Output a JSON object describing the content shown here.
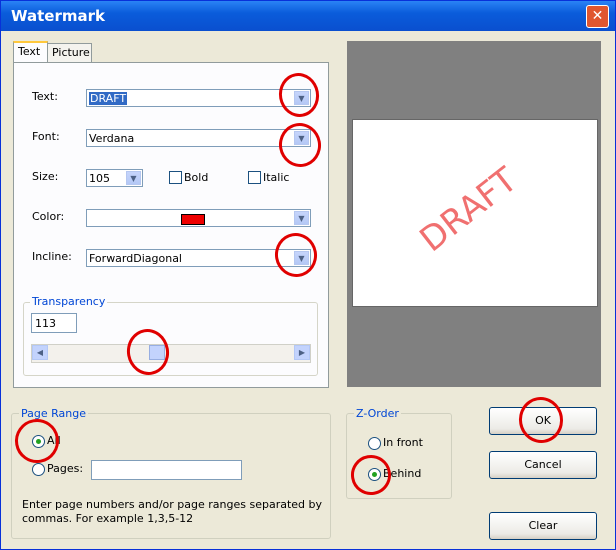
{
  "window": {
    "title": "Watermark",
    "close_glyph": "✕"
  },
  "tabs": [
    {
      "label": "Text"
    },
    {
      "label": "Picture"
    }
  ],
  "text_tab": {
    "text_label": "Text:",
    "text_value": "DRAFT",
    "font_label": "Font:",
    "font_value": "Verdana",
    "size_label": "Size:",
    "size_value": "105",
    "bold_label": "Bold",
    "italic_label": "Italic",
    "color_label": "Color:",
    "color_value": "#EE0000",
    "incline_label": "Incline:",
    "incline_value": "ForwardDiagonal",
    "transparency_label": "Transparency",
    "transparency_value": "113",
    "transparency_fraction": 0.44
  },
  "preview": {
    "watermark_text": "DRAFT",
    "watermark_color": "#F07070"
  },
  "page_range": {
    "title": "Page Range",
    "all_label": "All",
    "pages_label": "Pages:",
    "pages_value": "",
    "help_line1": "Enter page numbers and/or page ranges separated by",
    "help_line2": "commas. For example 1,3,5-12"
  },
  "z_order": {
    "title": "Z-Order",
    "in_front_label": "In front",
    "behind_label": "Behind"
  },
  "buttons": {
    "ok": "OK",
    "cancel": "Cancel",
    "clear": "Clear"
  },
  "icons": {
    "dropdown": "chevron-down-icon",
    "left": "arrow-left-icon",
    "right": "arrow-right-icon"
  }
}
